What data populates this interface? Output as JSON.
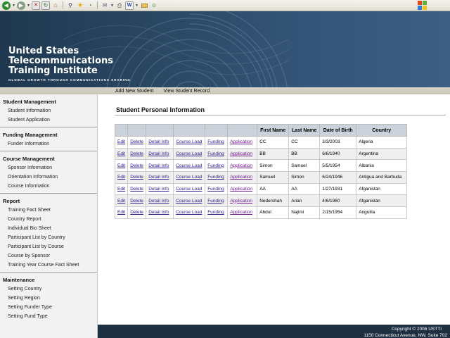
{
  "org": {
    "line1": "United States",
    "line2": "Telecommunications",
    "line3": "Training Institute",
    "tagline": "GLOBAL GROWTH THROUGH COMMUNICATIONS SHARING"
  },
  "subnav": {
    "add_new": "Add New Student",
    "view_record": "View Student Record"
  },
  "sidebar": {
    "student_management": {
      "title": "Student Management",
      "items": [
        "Student Information",
        "Student Application"
      ]
    },
    "funding_management": {
      "title": "Funding Management",
      "items": [
        "Funder Information"
      ]
    },
    "course_management": {
      "title": "Course Management",
      "items": [
        "Sponsor Information",
        "Orientation Information",
        "Course Information"
      ]
    },
    "report": {
      "title": "Report",
      "items": [
        "Training Fact Sheet",
        "Country Report",
        "Individual Bio Sheet",
        "Participant List by Country",
        "Participant List by Course",
        "Course by Sponsor",
        "Training Year Course Fact Sheet"
      ]
    },
    "maintenance": {
      "title": "Maintenance",
      "items": [
        "Setting Country",
        "Setting Region",
        "Setting Funder Type",
        "Setting Fund Type"
      ]
    }
  },
  "main": {
    "title": "Student Personal Information",
    "columns": [
      "First Name",
      "Last Name",
      "Date of Birth",
      "Country"
    ],
    "actions": [
      "Edit",
      "Delete",
      "Detail Info",
      "Course Load",
      "Funding",
      "Application"
    ],
    "rows": [
      [
        "CC",
        "CC",
        "3/3/2003",
        "Algeria"
      ],
      [
        "BB",
        "BB",
        "6/6/1940",
        "Argentina"
      ],
      [
        "Simon",
        "Samuel",
        "5/5/1954",
        "Albania"
      ],
      [
        "Samuel",
        "Simon",
        "6/24/1946",
        "Antigua and Barbuda"
      ],
      [
        "AA",
        "AA",
        "1/27/1931",
        "Afganistan"
      ],
      [
        "Nedershah",
        "Arian",
        "4/6/1960",
        "Afganistan"
      ],
      [
        "Abdul",
        "Najimi",
        "2/15/1954",
        "Anguilla"
      ]
    ]
  },
  "footer": {
    "copyright": "Copyright © 2006 USTTI",
    "address": "1150 Connecticut Avenue, NW, Suite 702"
  },
  "colors": {
    "banner": "#2c4a66",
    "footer": "#1e2f40",
    "header_row": "#ccd2dc",
    "link": "#2a1a8a"
  }
}
